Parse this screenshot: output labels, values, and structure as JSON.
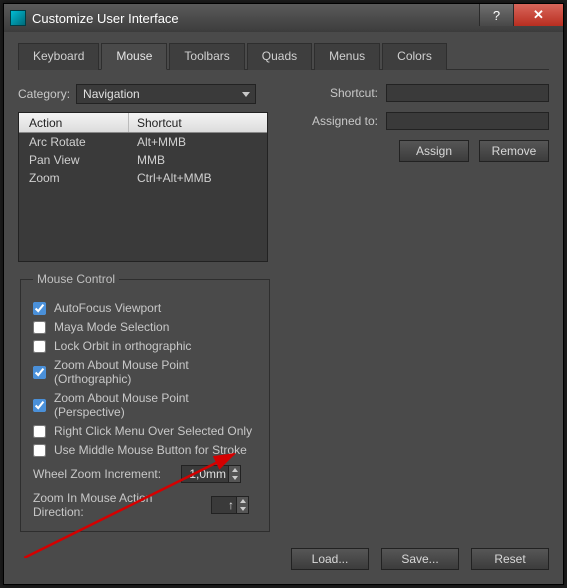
{
  "window": {
    "title": "Customize User Interface"
  },
  "tabs": [
    "Keyboard",
    "Mouse",
    "Toolbars",
    "Quads",
    "Menus",
    "Colors"
  ],
  "activeTab": 1,
  "category": {
    "label": "Category:",
    "value": "Navigation"
  },
  "actionList": {
    "headers": {
      "action": "Action",
      "shortcut": "Shortcut"
    },
    "rows": [
      {
        "action": "Arc Rotate",
        "shortcut": "Alt+MMB"
      },
      {
        "action": "Pan View",
        "shortcut": "MMB"
      },
      {
        "action": "Zoom",
        "shortcut": "Ctrl+Alt+MMB"
      }
    ]
  },
  "right": {
    "shortcut_label": "Shortcut:",
    "assigned_label": "Assigned to:",
    "assign": "Assign",
    "remove": "Remove"
  },
  "mouseControl": {
    "legend": "Mouse Control",
    "items": [
      {
        "label": "AutoFocus Viewport",
        "checked": true
      },
      {
        "label": "Maya Mode Selection",
        "checked": false
      },
      {
        "label": "Lock Orbit in orthographic",
        "checked": false
      },
      {
        "label": "Zoom About Mouse Point (Orthographic)",
        "checked": true
      },
      {
        "label": "Zoom About Mouse Point (Perspective)",
        "checked": true
      },
      {
        "label": "Right Click Menu Over Selected Only",
        "checked": false
      },
      {
        "label": "Use Middle Mouse Button for Stroke",
        "checked": false
      }
    ],
    "wheel_label": "Wheel Zoom Increment:",
    "wheel_value": "1,0mm",
    "dir_label": "Zoom In Mouse Action Direction:",
    "dir_value": "↑"
  },
  "footer": {
    "load": "Load...",
    "save": "Save...",
    "reset": "Reset"
  }
}
